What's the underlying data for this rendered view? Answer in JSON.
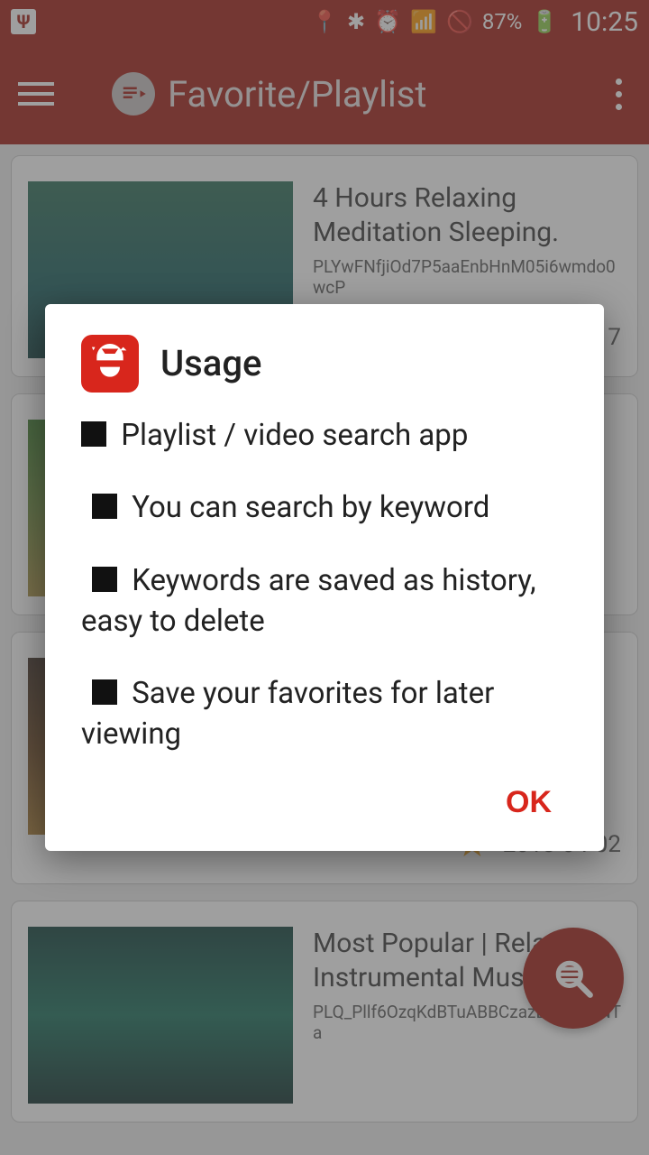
{
  "status": {
    "battery": "87%",
    "time": "10:25"
  },
  "header": {
    "title": "Favorite/Playlist"
  },
  "cards": [
    {
      "title": "4 Hours Relaxing Meditation Sleeping.",
      "sub": "PLYwFNfjiOd7P5aaEnbHnM05i6wmdo0wcP",
      "date": "2015-01-17"
    },
    {
      "title": "",
      "sub": "",
      "date": ""
    },
    {
      "title": "",
      "sub": "",
      "date": "2018-04-02"
    },
    {
      "title": "Most Popular | Relaxing Instrumental Music",
      "sub": "PLQ_Pllf6OzqKdBTuABBCzazB4i732pNTa",
      "date": ""
    }
  ],
  "dialog": {
    "title": "Usage",
    "lines": {
      "l1": "Playlist / video search app",
      "l2": "You can search by keyword",
      "l3": "Keywords are saved as history, easy to delete",
      "l4": "Save your favorites for later viewing"
    },
    "ok": "OK"
  }
}
